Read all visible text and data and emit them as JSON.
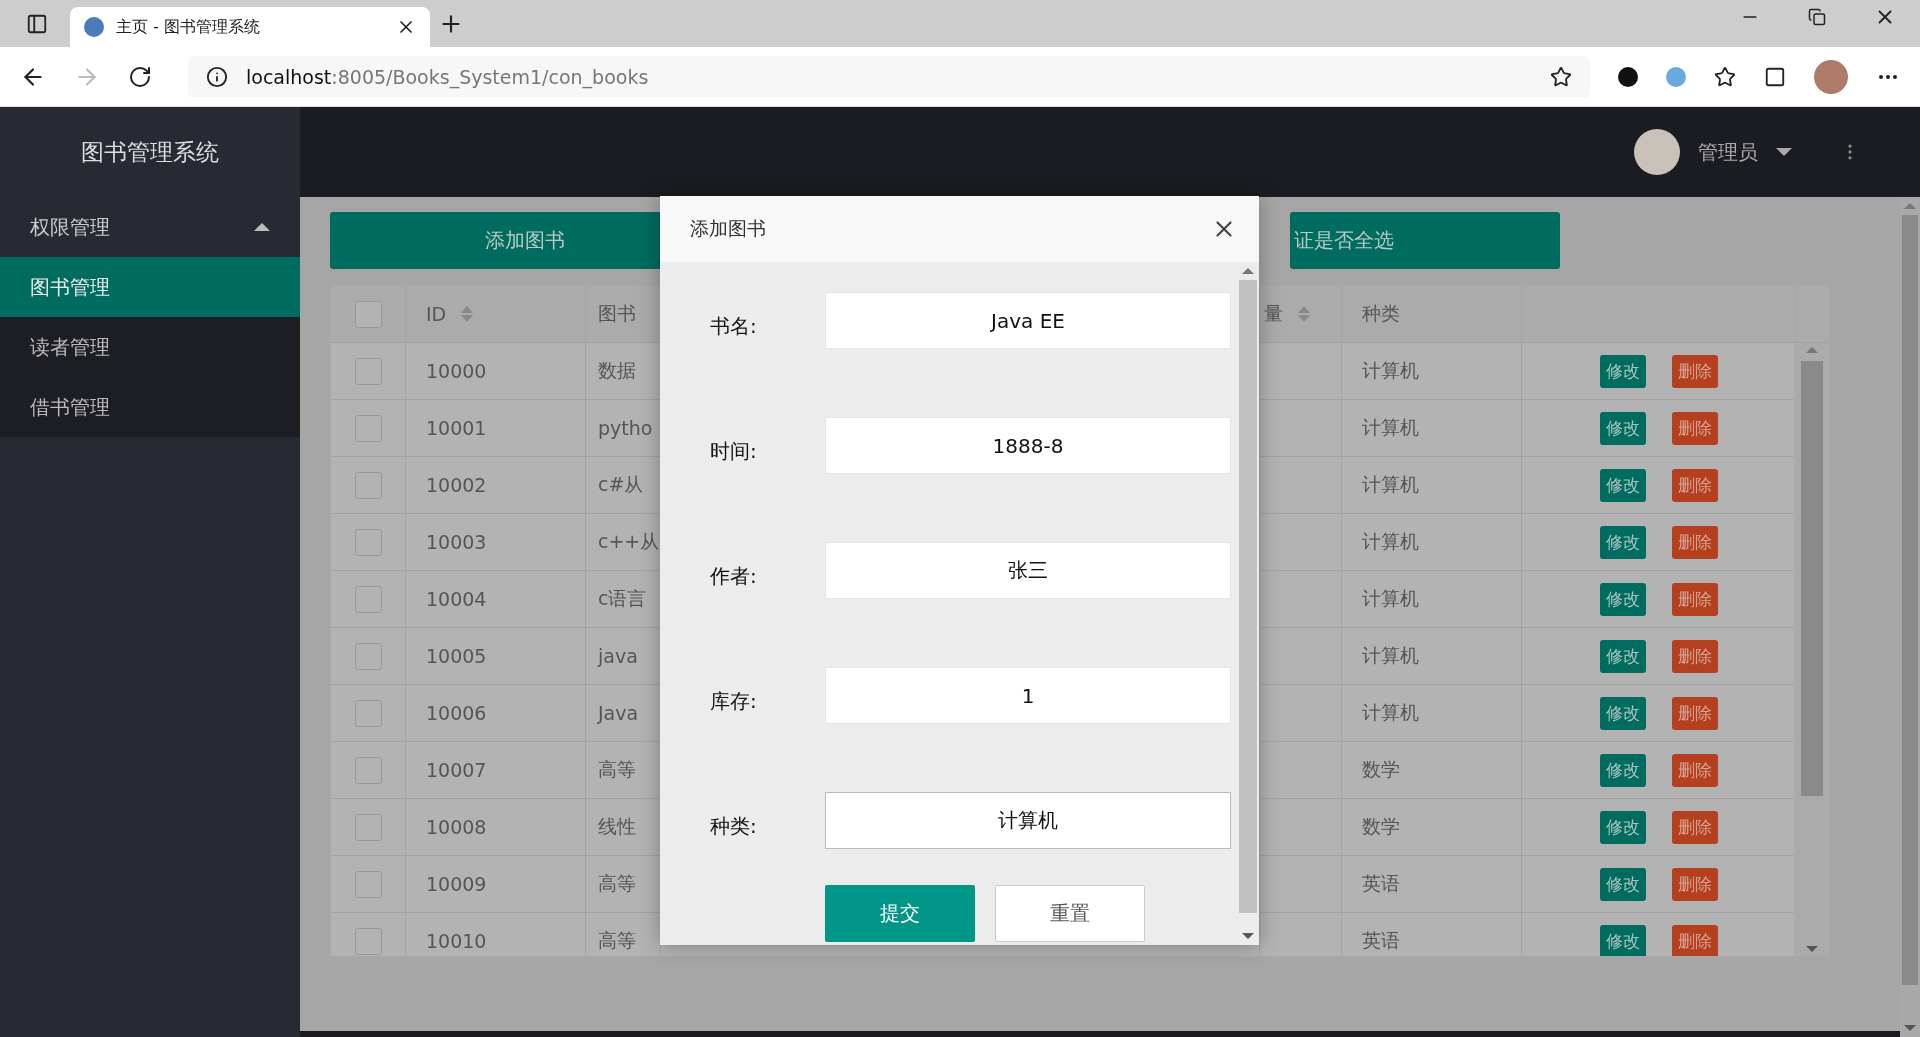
{
  "browser": {
    "tab_title": "主页 - 图书管理系统",
    "url_host": "localhost",
    "url_path": ":8005/Books_System1/con_books"
  },
  "sidebar": {
    "title": "图书管理系统",
    "items": [
      {
        "label": "权限管理",
        "kind": "group",
        "expanded": true,
        "selected": false
      },
      {
        "label": "图书管理",
        "kind": "link",
        "selected": true
      },
      {
        "label": "读者管理",
        "kind": "link",
        "selected": false
      },
      {
        "label": "借书管理",
        "kind": "link",
        "selected": false
      }
    ]
  },
  "header": {
    "user": "管理员"
  },
  "toolbar": {
    "buttons": [
      "添加图书",
      "证是否全选"
    ]
  },
  "table": {
    "all_checked": false,
    "columns": [
      {
        "label": "ID",
        "sortable": true
      },
      {
        "label": "图书"
      },
      {
        "label": "量",
        "sortable": true
      },
      {
        "label": "种类"
      }
    ],
    "rows": [
      {
        "id": "10000",
        "name": "数据",
        "category": "计算机",
        "checked": false,
        "edit": "修改",
        "delete": "删除"
      },
      {
        "id": "10001",
        "name": "pytho",
        "category": "计算机",
        "checked": false,
        "edit": "修改",
        "delete": "删除"
      },
      {
        "id": "10002",
        "name": "c#从",
        "category": "计算机",
        "checked": false,
        "edit": "修改",
        "delete": "删除"
      },
      {
        "id": "10003",
        "name": "c++从",
        "category": "计算机",
        "checked": false,
        "edit": "修改",
        "delete": "删除"
      },
      {
        "id": "10004",
        "name": "c语言",
        "category": "计算机",
        "checked": false,
        "edit": "修改",
        "delete": "删除"
      },
      {
        "id": "10005",
        "name": "java",
        "category": "计算机",
        "checked": false,
        "edit": "修改",
        "delete": "删除"
      },
      {
        "id": "10006",
        "name": "Java",
        "category": "计算机",
        "checked": false,
        "edit": "修改",
        "delete": "删除"
      },
      {
        "id": "10007",
        "name": "高等",
        "category": "数学",
        "checked": false,
        "edit": "修改",
        "delete": "删除"
      },
      {
        "id": "10008",
        "name": "线性",
        "category": "数学",
        "checked": false,
        "edit": "修改",
        "delete": "删除"
      },
      {
        "id": "10009",
        "name": "高等",
        "category": "英语",
        "checked": false,
        "edit": "修改",
        "delete": "删除"
      },
      {
        "id": "10010",
        "name": "高等",
        "category": "英语",
        "checked": false,
        "edit": "修改",
        "delete": "删除"
      }
    ]
  },
  "modal": {
    "title": "添加图书",
    "fields": [
      {
        "label": "书名:",
        "value": "Java EE",
        "focused": false
      },
      {
        "label": "时间:",
        "value": "1888-8",
        "focused": false
      },
      {
        "label": "作者:",
        "value": "张三",
        "focused": false
      },
      {
        "label": "库存:",
        "value": "1",
        "focused": false
      },
      {
        "label": "种类:",
        "value": "计算机",
        "focused": true
      }
    ],
    "buttons": [
      {
        "label": "提交",
        "kind": "primary"
      },
      {
        "label": "重置",
        "kind": "default"
      }
    ]
  }
}
